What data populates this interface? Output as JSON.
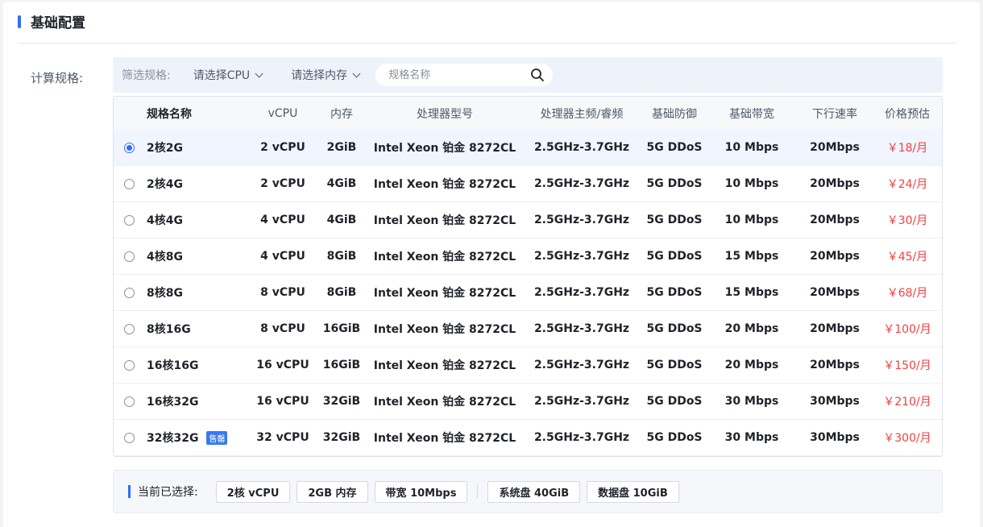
{
  "section": {
    "title": "基础配置"
  },
  "field": {
    "label": "计算规格:"
  },
  "filter": {
    "label": "筛选规格:",
    "cpu_select": "请选择CPU",
    "mem_select": "请选择内存",
    "search_placeholder": "规格名称",
    "search_value": ""
  },
  "table": {
    "headers": [
      "规格名称",
      "vCPU",
      "内存",
      "处理器型号",
      "处理器主频/睿频",
      "基础防御",
      "基础带宽",
      "下行速率",
      "价格预估"
    ],
    "rows": [
      {
        "name": "2核2G",
        "vcpu": "2 vCPU",
        "mem": "2GiB",
        "cpu_model": "Intel Xeon 铂金 8272CL",
        "freq": "2.5GHz-3.7GHz",
        "ddos": "5G DDoS",
        "bandwidth": "10 Mbps",
        "downlink": "20Mbps",
        "price": "￥18/月",
        "selected": true,
        "tag": ""
      },
      {
        "name": "2核4G",
        "vcpu": "2 vCPU",
        "mem": "4GiB",
        "cpu_model": "Intel Xeon 铂金 8272CL",
        "freq": "2.5GHz-3.7GHz",
        "ddos": "5G DDoS",
        "bandwidth": "10 Mbps",
        "downlink": "20Mbps",
        "price": "￥24/月",
        "selected": false,
        "tag": ""
      },
      {
        "name": "4核4G",
        "vcpu": "4 vCPU",
        "mem": "4GiB",
        "cpu_model": "Intel Xeon 铂金 8272CL",
        "freq": "2.5GHz-3.7GHz",
        "ddos": "5G DDoS",
        "bandwidth": "10 Mbps",
        "downlink": "20Mbps",
        "price": "￥30/月",
        "selected": false,
        "tag": ""
      },
      {
        "name": "4核8G",
        "vcpu": "4 vCPU",
        "mem": "8GiB",
        "cpu_model": "Intel Xeon 铂金 8272CL",
        "freq": "2.5GHz-3.7GHz",
        "ddos": "5G DDoS",
        "bandwidth": "15 Mbps",
        "downlink": "20Mbps",
        "price": "￥45/月",
        "selected": false,
        "tag": ""
      },
      {
        "name": "8核8G",
        "vcpu": "8 vCPU",
        "mem": "8GiB",
        "cpu_model": "Intel Xeon 铂金 8272CL",
        "freq": "2.5GHz-3.7GHz",
        "ddos": "5G DDoS",
        "bandwidth": "15 Mbps",
        "downlink": "20Mbps",
        "price": "￥68/月",
        "selected": false,
        "tag": ""
      },
      {
        "name": "8核16G",
        "vcpu": "8 vCPU",
        "mem": "16GiB",
        "cpu_model": "Intel Xeon 铂金 8272CL",
        "freq": "2.5GHz-3.7GHz",
        "ddos": "5G DDoS",
        "bandwidth": "20 Mbps",
        "downlink": "20Mbps",
        "price": "￥100/月",
        "selected": false,
        "tag": ""
      },
      {
        "name": "16核16G",
        "vcpu": "16 vCPU",
        "mem": "16GiB",
        "cpu_model": "Intel Xeon 铂金 8272CL",
        "freq": "2.5GHz-3.7GHz",
        "ddos": "5G DDoS",
        "bandwidth": "20 Mbps",
        "downlink": "20Mbps",
        "price": "￥150/月",
        "selected": false,
        "tag": ""
      },
      {
        "name": "16核32G",
        "vcpu": "16 vCPU",
        "mem": "32GiB",
        "cpu_model": "Intel Xeon 铂金 8272CL",
        "freq": "2.5GHz-3.7GHz",
        "ddos": "5G DDoS",
        "bandwidth": "30 Mbps",
        "downlink": "30Mbps",
        "price": "￥210/月",
        "selected": false,
        "tag": ""
      },
      {
        "name": "32核32G",
        "vcpu": "32 vCPU",
        "mem": "32GiB",
        "cpu_model": "Intel Xeon 铂金 8272CL",
        "freq": "2.5GHz-3.7GHz",
        "ddos": "5G DDoS",
        "bandwidth": "30 Mbps",
        "downlink": "30Mbps",
        "price": "￥300/月",
        "selected": false,
        "tag": "售罄"
      }
    ]
  },
  "summary": {
    "label": "当前已选择:",
    "chips_left": [
      "2核 vCPU",
      "2GB 内存",
      "带宽 10Mbps"
    ],
    "chips_right": [
      "系统盘 40GiB",
      "数据盘 10GiB"
    ]
  },
  "colors": {
    "accent": "#2f6bff",
    "price": "#f53f3f",
    "selected_row": "#f0f5ff"
  }
}
